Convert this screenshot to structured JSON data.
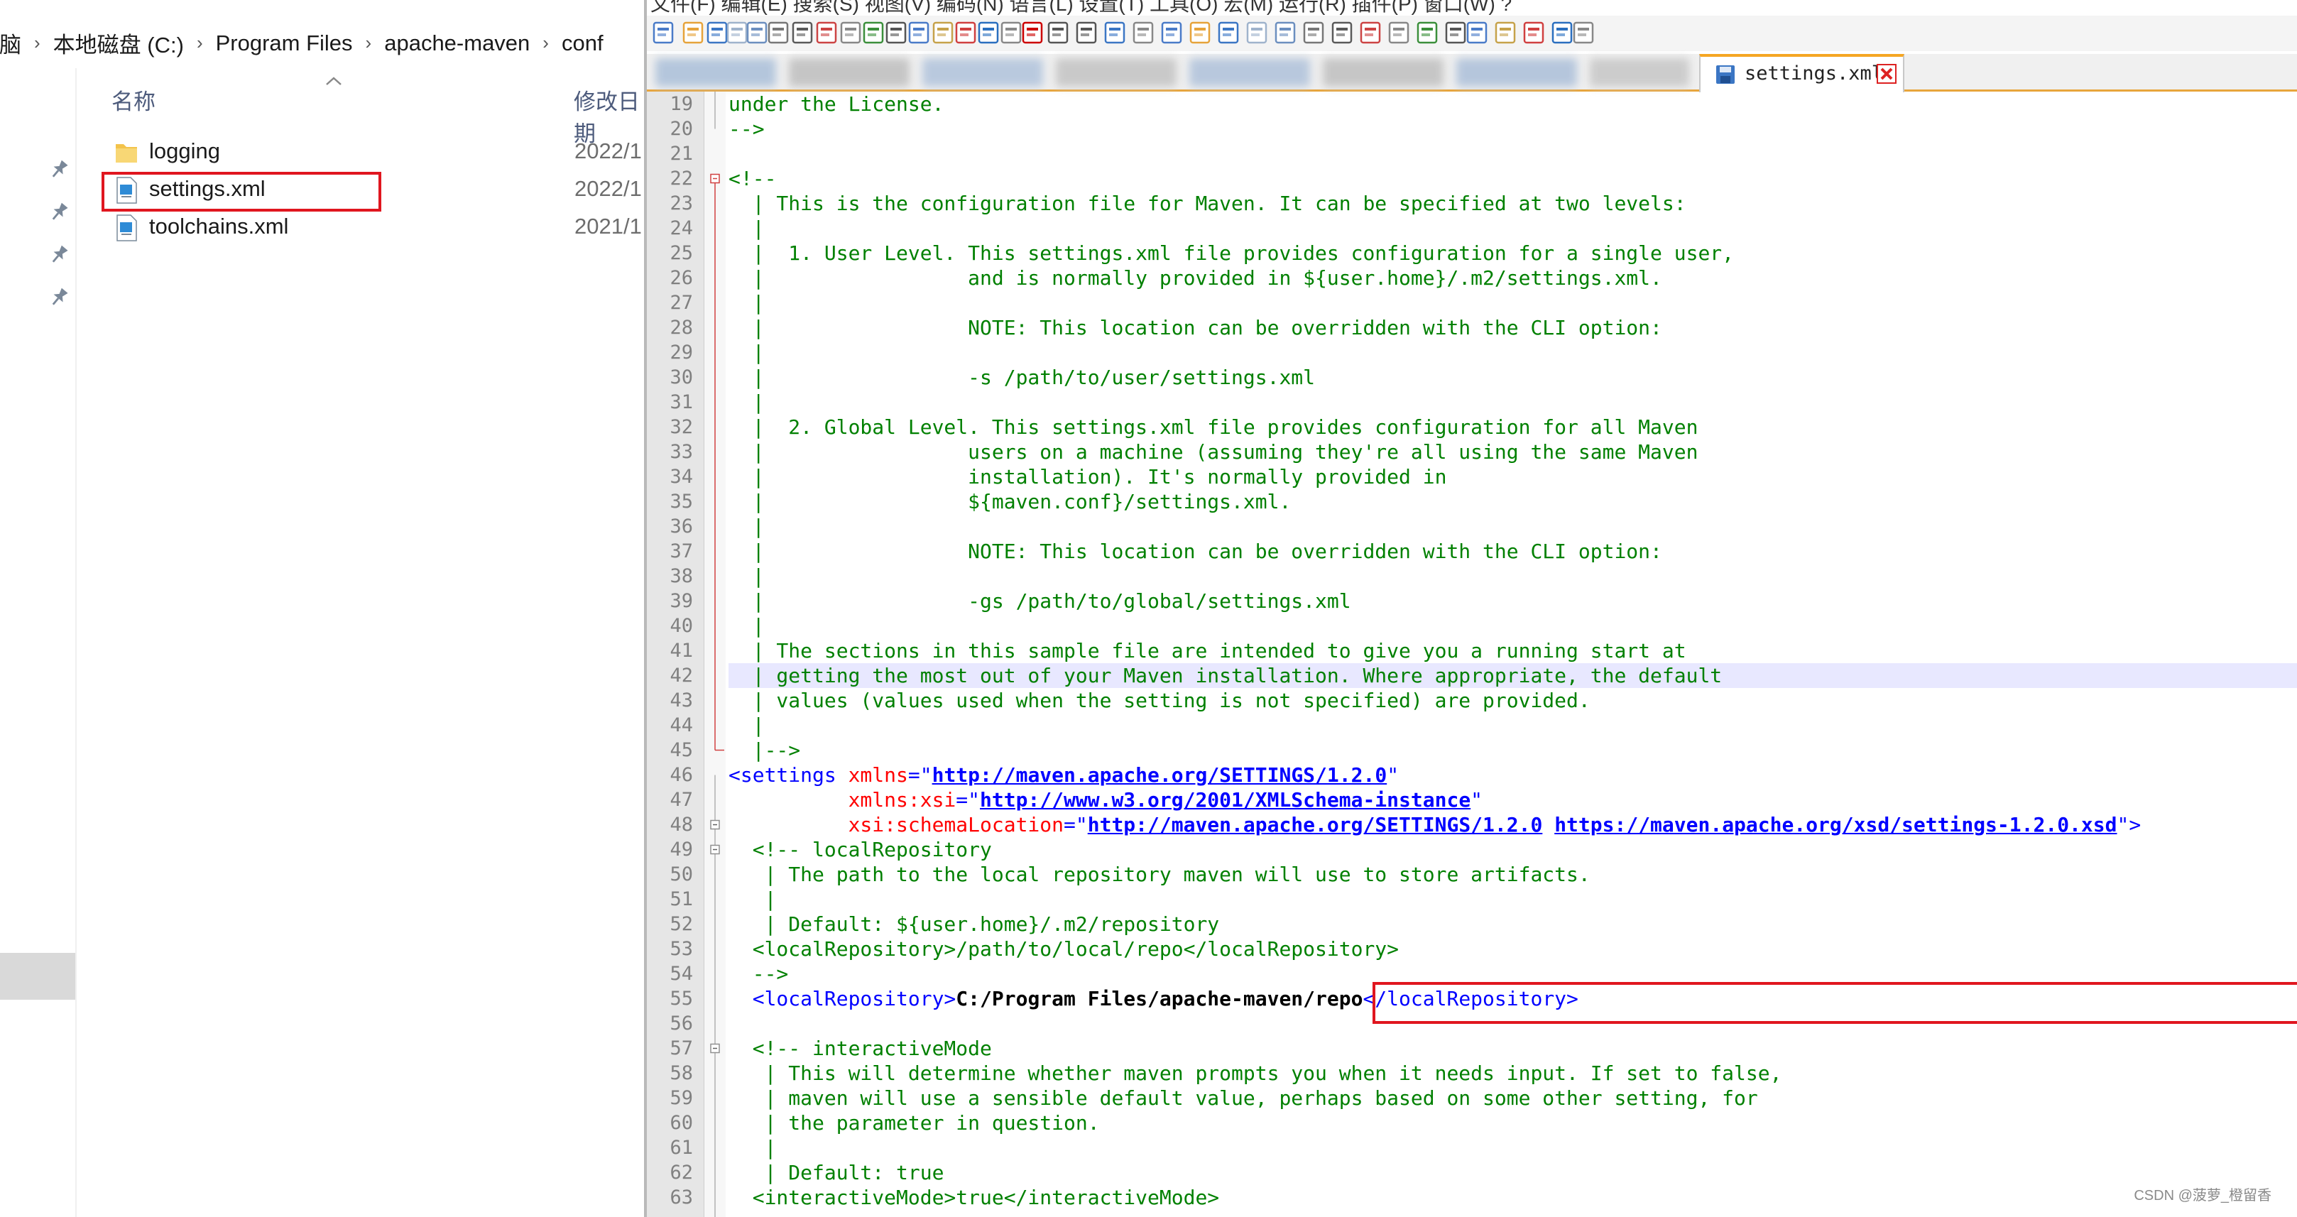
{
  "explorer": {
    "breadcrumb": [
      "电脑",
      "本地磁盘 (C:)",
      "Program Files",
      "apache-maven",
      "conf"
    ],
    "columns": {
      "name": "名称",
      "modified": "修改日期"
    },
    "files": [
      {
        "name": "logging",
        "date": "2022/1",
        "type": "folder"
      },
      {
        "name": "settings.xml",
        "date": "2022/1",
        "type": "xml",
        "highlighted": true
      },
      {
        "name": "toolchains.xml",
        "date": "2021/1",
        "type": "xml"
      }
    ]
  },
  "editor": {
    "menu_fragment": "文件(F)  编辑(E)  搜索(S)  视图(V)  编码(N)  语言(L)  设置(T)  工具(O)  宏(M)  运行(R)  插件(P)  窗口(W)  ?",
    "active_tab": "settings.xml",
    "current_line": 42,
    "highlight_line": 55,
    "lines": [
      {
        "n": 19,
        "t": [
          [
            "c",
            "under the License."
          ]
        ]
      },
      {
        "n": 20,
        "t": [
          [
            "c",
            "-->"
          ]
        ]
      },
      {
        "n": 21,
        "t": []
      },
      {
        "n": 22,
        "t": [
          [
            "c",
            "<!--"
          ]
        ]
      },
      {
        "n": 23,
        "t": [
          [
            "c",
            "  | This is the configuration file for Maven. It can be specified at two levels:"
          ]
        ]
      },
      {
        "n": 24,
        "t": [
          [
            "c",
            "  |"
          ]
        ]
      },
      {
        "n": 25,
        "t": [
          [
            "c",
            "  |  1. User Level. This settings.xml file provides configuration for a single user,"
          ]
        ]
      },
      {
        "n": 26,
        "t": [
          [
            "c",
            "  |                 and is normally provided in ${user.home}/.m2/settings.xml."
          ]
        ]
      },
      {
        "n": 27,
        "t": [
          [
            "c",
            "  |"
          ]
        ]
      },
      {
        "n": 28,
        "t": [
          [
            "c",
            "  |                 NOTE: This location can be overridden with the CLI option:"
          ]
        ]
      },
      {
        "n": 29,
        "t": [
          [
            "c",
            "  |"
          ]
        ]
      },
      {
        "n": 30,
        "t": [
          [
            "c",
            "  |                 -s /path/to/user/settings.xml"
          ]
        ]
      },
      {
        "n": 31,
        "t": [
          [
            "c",
            "  |"
          ]
        ]
      },
      {
        "n": 32,
        "t": [
          [
            "c",
            "  |  2. Global Level. This settings.xml file provides configuration for all Maven"
          ]
        ]
      },
      {
        "n": 33,
        "t": [
          [
            "c",
            "  |                 users on a machine (assuming they're all using the same Maven"
          ]
        ]
      },
      {
        "n": 34,
        "t": [
          [
            "c",
            "  |                 installation). It's normally provided in"
          ]
        ]
      },
      {
        "n": 35,
        "t": [
          [
            "c",
            "  |                 ${maven.conf}/settings.xml."
          ]
        ]
      },
      {
        "n": 36,
        "t": [
          [
            "c",
            "  |"
          ]
        ]
      },
      {
        "n": 37,
        "t": [
          [
            "c",
            "  |                 NOTE: This location can be overridden with the CLI option:"
          ]
        ]
      },
      {
        "n": 38,
        "t": [
          [
            "c",
            "  |"
          ]
        ]
      },
      {
        "n": 39,
        "t": [
          [
            "c",
            "  |                 -gs /path/to/global/settings.xml"
          ]
        ]
      },
      {
        "n": 40,
        "t": [
          [
            "c",
            "  |"
          ]
        ]
      },
      {
        "n": 41,
        "t": [
          [
            "c",
            "  | The sections in this sample file are intended to give you a running start at"
          ]
        ]
      },
      {
        "n": 42,
        "t": [
          [
            "c",
            "  | getting the most out of your Maven installation. Where appropriate, the default"
          ]
        ]
      },
      {
        "n": 43,
        "t": [
          [
            "c",
            "  | values (values used when the setting is not specified) are provided."
          ]
        ]
      },
      {
        "n": 44,
        "t": [
          [
            "c",
            "  |"
          ]
        ]
      },
      {
        "n": 45,
        "t": [
          [
            "c",
            "  |-->"
          ]
        ]
      },
      {
        "n": 46,
        "t": [
          [
            "g",
            "<settings "
          ],
          [
            "a",
            "xmlns"
          ],
          [
            "g",
            "=\""
          ],
          [
            "u",
            "http://maven.apache.org/SETTINGS/1.2.0"
          ],
          [
            "g",
            "\""
          ]
        ]
      },
      {
        "n": 47,
        "t": [
          [
            "a",
            "          xmlns:xsi"
          ],
          [
            "g",
            "=\""
          ],
          [
            "u",
            "http://www.w3.org/2001/XMLSchema-instance"
          ],
          [
            "g",
            "\""
          ]
        ]
      },
      {
        "n": 48,
        "t": [
          [
            "a",
            "          xsi:schemaLocation"
          ],
          [
            "g",
            "=\""
          ],
          [
            "u",
            "http://maven.apache.org/SETTINGS/1.2.0"
          ],
          [
            "s",
            " "
          ],
          [
            "u",
            "https://maven.apache.org/xsd/settings-1.2.0.xsd"
          ],
          [
            "g",
            "\">"
          ]
        ]
      },
      {
        "n": 49,
        "t": [
          [
            "c",
            "  <!-- localRepository"
          ]
        ]
      },
      {
        "n": 50,
        "t": [
          [
            "c",
            "   | The path to the local repository maven will use to store artifacts."
          ]
        ]
      },
      {
        "n": 51,
        "t": [
          [
            "c",
            "   |"
          ]
        ]
      },
      {
        "n": 52,
        "t": [
          [
            "c",
            "   | Default: ${user.home}/.m2/repository"
          ]
        ]
      },
      {
        "n": 53,
        "t": [
          [
            "c",
            "  <localRepository>/path/to/local/repo</localRepository>"
          ]
        ]
      },
      {
        "n": 54,
        "t": [
          [
            "c",
            "  -->"
          ]
        ]
      },
      {
        "n": 55,
        "t": [
          [
            "g",
            "  <localRepository>"
          ],
          [
            "x",
            "C:/Program Files/apache-maven/repo"
          ],
          [
            "g",
            "</localRepository>"
          ]
        ]
      },
      {
        "n": 56,
        "t": []
      },
      {
        "n": 57,
        "t": [
          [
            "c",
            "  <!-- interactiveMode"
          ]
        ]
      },
      {
        "n": 58,
        "t": [
          [
            "c",
            "   | This will determine whether maven prompts you when it needs input. If set to false,"
          ]
        ]
      },
      {
        "n": 59,
        "t": [
          [
            "c",
            "   | maven will use a sensible default value, perhaps based on some other setting, for"
          ]
        ]
      },
      {
        "n": 60,
        "t": [
          [
            "c",
            "   | the parameter in question."
          ]
        ]
      },
      {
        "n": 61,
        "t": [
          [
            "c",
            "   |"
          ]
        ]
      },
      {
        "n": 62,
        "t": [
          [
            "c",
            "   | Default: true"
          ]
        ]
      },
      {
        "n": 63,
        "t": [
          [
            "c",
            "  <interactiveMode>true</interactiveMode>"
          ]
        ]
      }
    ]
  },
  "watermark": "CSDN @菠萝_橙留香",
  "colors": {
    "comment": "#008000",
    "tag": "#0000ff",
    "attr": "#ff0000",
    "string": "#8000ff",
    "highlight_box": "#e0161f",
    "current_line": "#e8e8ff"
  }
}
